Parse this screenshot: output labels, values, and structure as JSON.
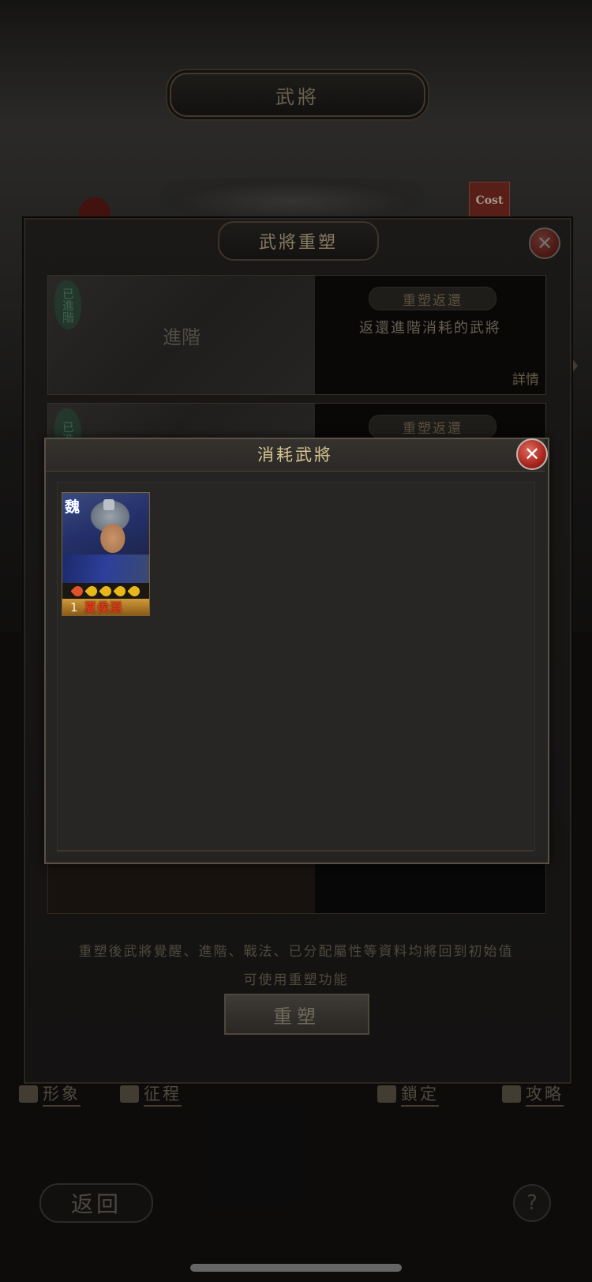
{
  "screen": {
    "title": "武將",
    "cost_badge": "Cost"
  },
  "panel": {
    "title": "武將重塑",
    "cards": [
      {
        "seal": "已進階",
        "label": "進階",
        "pill": "重塑返還",
        "description": "返還進階消耗的武將",
        "detail": "詳情"
      },
      {
        "seal": "已進",
        "pill": "重塑返還"
      }
    ],
    "hint_line_1": "重塑後武將覺醒、進階、戰法、已分配屬性等資料均將回到初始值",
    "hint_line_2": "可使用重塑功能",
    "rebuild_button": "重塑"
  },
  "tabs": [
    {
      "label": "形象",
      "icon": "figure-icon"
    },
    {
      "label": "征程",
      "icon": "flag-icon"
    },
    {
      "label": "鎖定",
      "icon": "lock-icon"
    },
    {
      "label": "攻略",
      "icon": "guide-icon"
    }
  ],
  "footer": {
    "back_button": "返回",
    "help_button": "?"
  },
  "dialog": {
    "title": "消耗武將",
    "generals": [
      {
        "faction": "魏",
        "level": "1",
        "name": "夏侯淵",
        "stars": 5,
        "star_colors": [
          "#e0532a",
          "#e8b81a",
          "#e8b81a",
          "#e8b81a",
          "#e8b81a"
        ]
      }
    ]
  },
  "colors": {
    "accent_gold": "#d8c694",
    "close_red": "#a8251d",
    "wei_blue": "#2b4eb0"
  }
}
